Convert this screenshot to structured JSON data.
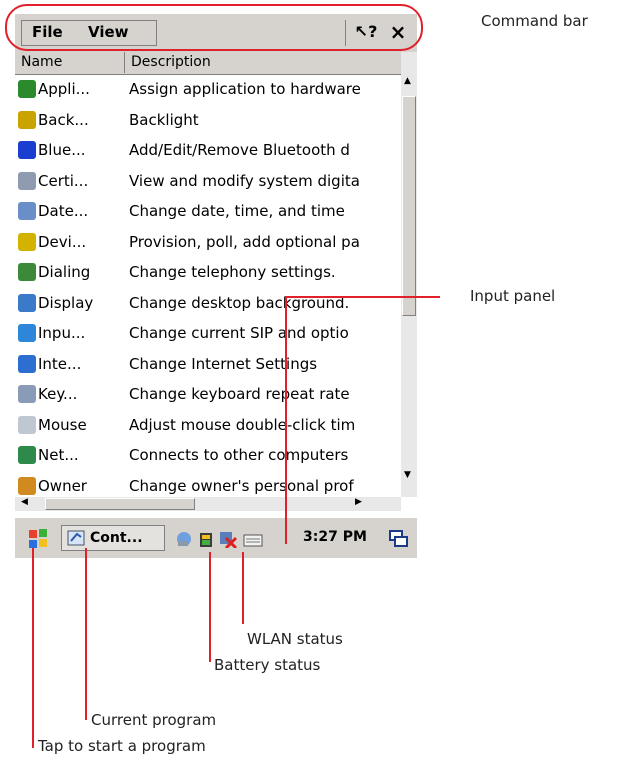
{
  "menu": {
    "file": "File",
    "view": "View"
  },
  "cmdbar": {
    "help_label": "↖?",
    "close_label": "×"
  },
  "columns": {
    "name": "Name",
    "description": "Description"
  },
  "items": [
    {
      "name": "Appli...",
      "description": "Assign application to hardware",
      "icon": "applications-icon",
      "color": "#2b8a2b"
    },
    {
      "name": "Back...",
      "description": "Backlight",
      "icon": "backlight-icon",
      "color": "#c9a400"
    },
    {
      "name": "Blue...",
      "description": "Add/Edit/Remove Bluetooth d",
      "icon": "bluetooth-icon",
      "color": "#1a3fd0"
    },
    {
      "name": "Certi...",
      "description": "View and modify system digita",
      "icon": "certificates-icon",
      "color": "#8f9bb0"
    },
    {
      "name": "Date...",
      "description": "Change date, time, and time",
      "icon": "date-time-icon",
      "color": "#6a8fc8"
    },
    {
      "name": "Devi...",
      "description": "Provision, poll, add optional pa",
      "icon": "device-management-icon",
      "color": "#d4b200"
    },
    {
      "name": "Dialing",
      "description": "Change telephony settings.",
      "icon": "dialing-icon",
      "color": "#3a8a3a"
    },
    {
      "name": "Display",
      "description": "Change desktop background.",
      "icon": "display-icon",
      "color": "#3b79c9"
    },
    {
      "name": "Inpu...",
      "description": "Change current SIP and optio",
      "icon": "input-panel-icon",
      "color": "#2d86d8"
    },
    {
      "name": "Inte...",
      "description": "Change Internet Settings",
      "icon": "internet-options-icon",
      "color": "#2c6fd0"
    },
    {
      "name": "Key...",
      "description": "Change keyboard repeat rate",
      "icon": "keyboard-icon",
      "color": "#8a9bb8"
    },
    {
      "name": "Mouse",
      "description": "Adjust mouse double-click tim",
      "icon": "mouse-icon",
      "color": "#bfc7d2"
    },
    {
      "name": "Net...",
      "description": "Connects to other computers",
      "icon": "network-icon",
      "color": "#2e8a4a"
    },
    {
      "name": "Owner",
      "description": "Change owner's personal prof",
      "icon": "owner-icon",
      "color": "#d08a20"
    }
  ],
  "taskbar": {
    "current_program": "Cont...",
    "clock": "3:27 PM"
  },
  "callouts": {
    "command_bar": "Command bar",
    "input_panel": "Input panel",
    "wlan_status": "WLAN status",
    "battery_status": "Battery status",
    "current_program": "Current program",
    "start": "Tap to start a program"
  },
  "accent_color": "#e0202a"
}
